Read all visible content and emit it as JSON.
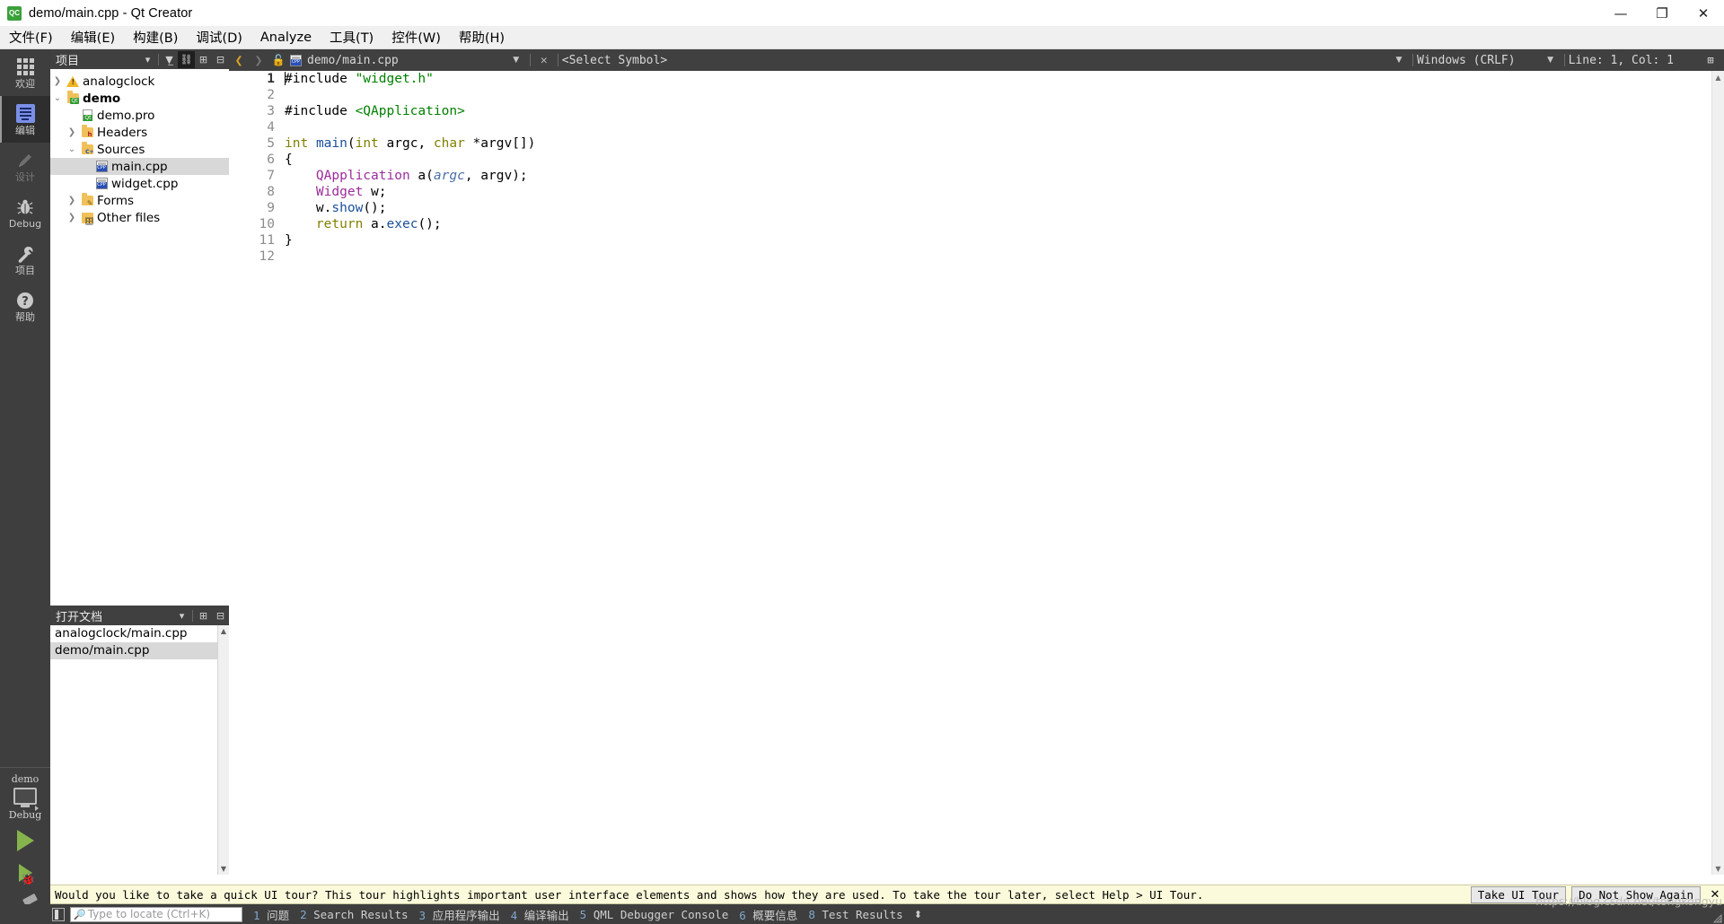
{
  "window": {
    "title": "demo/main.cpp - Qt Creator",
    "app_icon": "qt-creator-icon",
    "controls": {
      "minimize": "—",
      "maximize": "❐",
      "close": "✕"
    }
  },
  "menubar": {
    "items": [
      {
        "label": "文件(F)",
        "mnemonic": "F"
      },
      {
        "label": "编辑(E)",
        "mnemonic": "E"
      },
      {
        "label": "构建(B)",
        "mnemonic": "B"
      },
      {
        "label": "调试(D)",
        "mnemonic": "D"
      },
      {
        "label": "Analyze",
        "mnemonic": "A"
      },
      {
        "label": "工具(T)",
        "mnemonic": "T"
      },
      {
        "label": "控件(W)",
        "mnemonic": "W"
      },
      {
        "label": "帮助(H)",
        "mnemonic": "H"
      }
    ]
  },
  "modebar": {
    "items": [
      {
        "label": "欢迎",
        "icon": "grid-icon",
        "state": "normal"
      },
      {
        "label": "编辑",
        "icon": "document-icon",
        "state": "active"
      },
      {
        "label": "设计",
        "icon": "pencil-icon",
        "state": "disabled"
      },
      {
        "label": "Debug",
        "icon": "bug-icon",
        "state": "normal"
      },
      {
        "label": "项目",
        "icon": "wrench-icon",
        "state": "normal"
      },
      {
        "label": "帮助",
        "icon": "question-icon",
        "state": "normal"
      }
    ],
    "kit": {
      "project": "demo",
      "build_config": "Debug",
      "icon": "monitor-icon"
    },
    "actions": [
      {
        "name": "run",
        "icon": "play-triangle-icon"
      },
      {
        "name": "debug",
        "icon": "play-bug-icon"
      },
      {
        "name": "build",
        "icon": "hammer-icon"
      }
    ]
  },
  "project_panel": {
    "title": "项目",
    "toolbar": [
      {
        "name": "filter",
        "icon": "filter-icon",
        "pressed": false
      },
      {
        "name": "sync-with-editor",
        "icon": "link-icon",
        "pressed": true
      },
      {
        "name": "split",
        "icon": "split-icon",
        "pressed": false
      },
      {
        "name": "minimize",
        "icon": "minimize-icon",
        "pressed": false
      }
    ],
    "tree": [
      {
        "label": "analogclock",
        "icon": "warning-icon",
        "indent": 0,
        "arrow": "right",
        "bold": false,
        "selected": false
      },
      {
        "label": "demo",
        "icon": "qt-folder-icon",
        "indent": 0,
        "arrow": "down",
        "bold": true,
        "selected": false
      },
      {
        "label": "demo.pro",
        "icon": "qt-file-icon",
        "indent": 1,
        "arrow": "",
        "bold": false,
        "selected": false
      },
      {
        "label": "Headers",
        "icon": "h-folder-icon",
        "indent": 1,
        "arrow": "right",
        "bold": false,
        "selected": false
      },
      {
        "label": "Sources",
        "icon": "cpp-folder-icon",
        "indent": 1,
        "arrow": "down",
        "bold": false,
        "selected": false
      },
      {
        "label": "main.cpp",
        "icon": "cpp-file-icon",
        "indent": 2,
        "arrow": "",
        "bold": false,
        "selected": true
      },
      {
        "label": "widget.cpp",
        "icon": "cpp-file-icon",
        "indent": 2,
        "arrow": "",
        "bold": false,
        "selected": false
      },
      {
        "label": "Forms",
        "icon": "forms-folder-icon",
        "indent": 1,
        "arrow": "right",
        "bold": false,
        "selected": false
      },
      {
        "label": "Other files",
        "icon": "other-folder-icon",
        "indent": 1,
        "arrow": "right",
        "bold": false,
        "selected": false
      }
    ]
  },
  "open_documents": {
    "title": "打开文档",
    "toolbar": [
      {
        "name": "split",
        "icon": "split-icon"
      },
      {
        "name": "minimize",
        "icon": "minimize-icon"
      }
    ],
    "items": [
      {
        "label": "analogclock/main.cpp",
        "selected": false
      },
      {
        "label": "demo/main.cpp",
        "selected": true
      }
    ]
  },
  "editor_toolbar": {
    "back_icon": "chevron-left-icon",
    "forward_icon": "chevron-right-icon",
    "lock_icon": "unlock-icon",
    "file_icon": "cpp-file-icon",
    "filename": "demo/main.cpp",
    "close_icon": "close-icon",
    "symbol_selector": "<Select Symbol>",
    "line_ending": "Windows (CRLF)",
    "cursor_position": "Line: 1, Col: 1",
    "split_icon": "split-icon"
  },
  "editor": {
    "line_numbers": [
      "1",
      "2",
      "3",
      "4",
      "5",
      "6",
      "7",
      "8",
      "9",
      "10",
      "11",
      "12"
    ],
    "current_line": 1,
    "fold_marker_line": 5,
    "lines": [
      [
        {
          "t": "#include ",
          "c": "pp"
        },
        {
          "t": "\"widget.h\"",
          "c": "st"
        }
      ],
      [],
      [
        {
          "t": "#include ",
          "c": "pp"
        },
        {
          "t": "<QApplication>",
          "c": "st"
        }
      ],
      [],
      [
        {
          "t": "int",
          "c": "k"
        },
        {
          "t": " ",
          "c": ""
        },
        {
          "t": "main",
          "c": "fn"
        },
        {
          "t": "(",
          "c": ""
        },
        {
          "t": "int",
          "c": "k"
        },
        {
          "t": " argc, ",
          "c": ""
        },
        {
          "t": "char",
          "c": "k"
        },
        {
          "t": " *argv[])",
          "c": ""
        }
      ],
      [
        {
          "t": "{",
          "c": ""
        }
      ],
      [
        {
          "t": "    ",
          "c": ""
        },
        {
          "t": "QApplication",
          "c": "cls"
        },
        {
          "t": " a(",
          "c": ""
        },
        {
          "t": "argc",
          "c": "par"
        },
        {
          "t": ", argv);",
          "c": ""
        }
      ],
      [
        {
          "t": "    ",
          "c": ""
        },
        {
          "t": "Widget",
          "c": "cls"
        },
        {
          "t": " w;",
          "c": ""
        }
      ],
      [
        {
          "t": "    w.",
          "c": ""
        },
        {
          "t": "show",
          "c": "fn"
        },
        {
          "t": "();",
          "c": ""
        }
      ],
      [
        {
          "t": "    ",
          "c": ""
        },
        {
          "t": "return",
          "c": "k"
        },
        {
          "t": " a.",
          "c": ""
        },
        {
          "t": "exec",
          "c": "fn"
        },
        {
          "t": "();",
          "c": ""
        }
      ],
      [
        {
          "t": "}",
          "c": ""
        }
      ],
      []
    ]
  },
  "banner": {
    "message": "Would you like to take a quick UI tour? This tour highlights important user interface elements and shows how they are used. To take the tour later, select Help > UI Tour.",
    "take_tour_label": "Take UI Tour",
    "dismiss_label": "Do Not Show Again",
    "close_icon": "close-icon"
  },
  "statusbar": {
    "sidebar_toggle_icon": "sidebar-toggle-icon",
    "locator_placeholder": "Type to locate (Ctrl+K)",
    "locator_value": "",
    "search_icon": "search-icon",
    "panes": [
      {
        "num": "1",
        "label": "问题"
      },
      {
        "num": "2",
        "label": "Search Results"
      },
      {
        "num": "3",
        "label": "应用程序输出"
      },
      {
        "num": "4",
        "label": "编译输出"
      },
      {
        "num": "5",
        "label": "QML Debugger Console"
      },
      {
        "num": "6",
        "label": "概要信息"
      },
      {
        "num": "8",
        "label": "Test Results"
      }
    ],
    "updown_icon": "up-down-arrow-icon"
  },
  "watermark": {
    "text": "https://blog.csdn.net/tongkongyu"
  },
  "colors": {
    "accent_blue": "#7b8fe8",
    "panel_dark": "#3e3e3e",
    "toolbar_dark": "#404040",
    "selection": "#d8d8d8",
    "banner_bg": "#fbfbdc",
    "keyword": "#808000",
    "string": "#008000",
    "class": "#9b2d9b",
    "function": "#1b4f9b",
    "parameter": "#4a6fa5"
  }
}
